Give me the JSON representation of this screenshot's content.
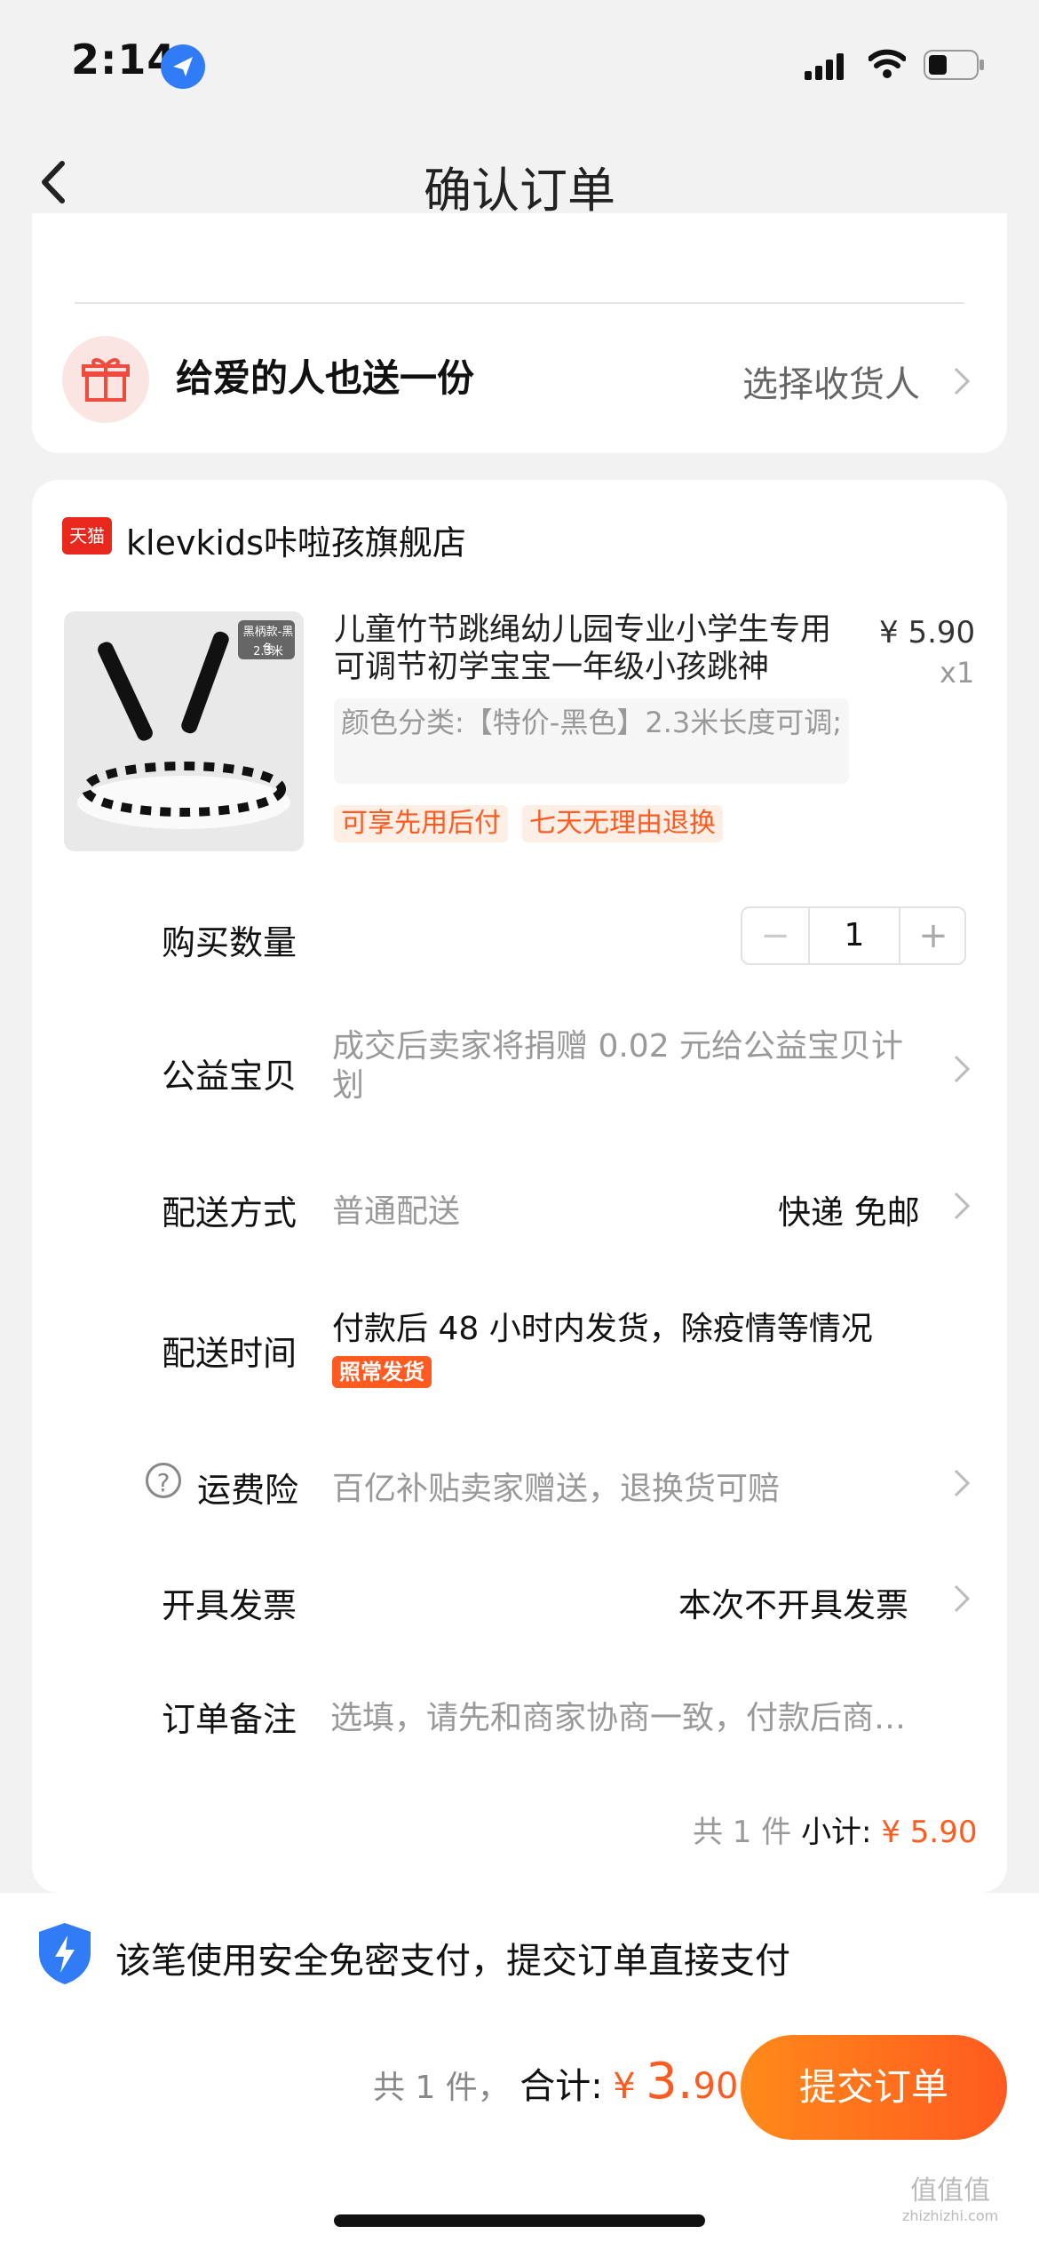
{
  "status": {
    "time": "2:14"
  },
  "nav": {
    "title": "确认订单"
  },
  "gift": {
    "text": "给爱的人也送一份",
    "receiver": "选择收货人"
  },
  "store": {
    "badge": "天猫",
    "name": "klevkids咔啦孩旗舰店"
  },
  "product": {
    "title": "儿童竹节跳绳幼儿园专业小学生专用可调节初学宝宝一年级小孩跳神",
    "price": "¥ 5.90",
    "qty_label": "x1",
    "sku": "颜色分类:【特价-黑色】2.3米长度可调;",
    "tags": [
      "可享先用后付",
      "七天无理由退换"
    ],
    "image_badge": "黑柄款-黑色",
    "image_sub": "2.3米"
  },
  "rows": {
    "quantity": {
      "label": "购买数量",
      "value": "1",
      "minus": "−",
      "plus": "+"
    },
    "charity": {
      "label": "公益宝贝",
      "value": "成交后卖家将捐赠 0.02 元给公益宝贝计划"
    },
    "delivery": {
      "label": "配送方式",
      "value": "普通配送",
      "right": "快递 免邮"
    },
    "ship_time": {
      "label": "配送时间",
      "value": "付款后 48 小时内发货，除疫情等情况",
      "badge": "照常发货"
    },
    "insurance": {
      "label": "运费险",
      "value": "百亿补贴卖家赠送，退换货可赔"
    },
    "invoice": {
      "label": "开具发票",
      "value": "本次不开具发票"
    },
    "note": {
      "label": "订单备注",
      "placeholder": "选填，请先和商家协商一致，付款后商…"
    }
  },
  "subtotal": {
    "count": "共 1 件",
    "label": "小计:",
    "amount": "¥ 5.90"
  },
  "footer": {
    "secure": "该笔使用安全免密支付，提交订单直接支付",
    "count": "共 1 件，",
    "label": "合计:",
    "currency": "¥",
    "amount_int": "3.",
    "amount_dec": "90",
    "submit": "提交订单"
  },
  "watermark": {
    "text": "值值值",
    "site": "zhizhizhi.com"
  }
}
